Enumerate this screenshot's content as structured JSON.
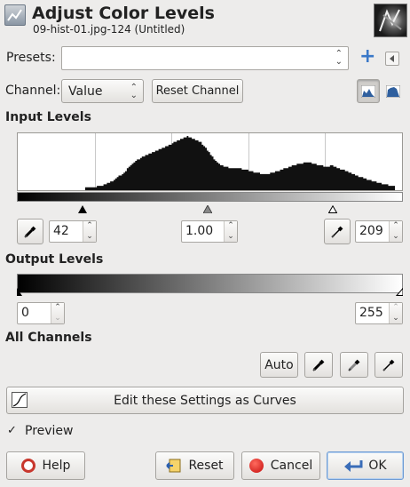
{
  "header": {
    "title": "Adjust Color Levels",
    "subtitle": "09-hist-01.jpg-124 (Untitled)"
  },
  "presets": {
    "label": "Presets:",
    "value": ""
  },
  "channel": {
    "label": "Channel:",
    "value": "Value",
    "reset_label": "Reset Channel"
  },
  "input_levels": {
    "heading": "Input Levels",
    "low": "42",
    "gamma": "1.00",
    "high": "209"
  },
  "output_levels": {
    "heading": "Output Levels",
    "low": "0",
    "high": "255"
  },
  "all_channels": {
    "heading": "All Channels",
    "auto_label": "Auto"
  },
  "curves_button": {
    "label": "Edit these Settings as Curves"
  },
  "preview": {
    "label": "Preview",
    "checked": true
  },
  "footer": {
    "help": "Help",
    "reset": "Reset",
    "cancel": "Cancel",
    "ok": "OK"
  },
  "histogram": [
    2,
    2,
    2,
    2,
    2,
    2,
    2,
    3,
    3,
    3,
    3,
    4,
    4,
    5,
    5,
    6,
    6,
    7,
    8,
    9,
    10,
    10,
    11,
    12,
    13,
    15,
    16,
    17,
    18,
    19,
    20,
    21,
    21,
    22,
    23,
    23,
    24,
    24,
    25,
    25,
    26,
    26,
    27,
    27,
    28,
    28,
    29,
    29,
    30,
    30,
    31,
    31,
    32,
    33,
    33,
    34,
    34,
    35,
    35,
    36,
    36,
    37,
    36,
    36,
    35,
    35,
    34,
    34,
    33,
    33,
    31,
    30,
    29,
    27,
    26,
    24,
    23,
    21,
    20,
    19,
    18,
    17,
    17,
    16,
    16,
    16,
    15,
    15,
    15,
    15,
    15,
    15,
    15,
    15,
    14,
    14,
    14,
    14,
    13,
    13,
    13,
    12,
    12,
    12,
    12,
    11,
    11,
    11,
    11,
    11,
    11,
    12,
    12,
    12,
    13,
    13,
    13,
    14,
    14,
    15,
    15,
    15,
    16,
    16,
    17,
    17,
    17,
    18,
    18,
    18,
    18,
    19,
    19,
    19,
    19,
    19,
    18,
    18,
    18,
    17,
    17,
    17,
    17,
    16,
    16,
    16,
    16,
    17,
    17,
    16,
    16,
    15,
    15,
    14,
    14,
    14,
    13,
    13,
    12,
    12,
    11,
    11,
    10,
    10,
    9,
    9,
    9,
    8,
    8,
    7,
    7,
    7,
    6,
    6,
    6,
    5,
    5,
    5,
    4,
    4,
    4,
    4,
    3,
    3,
    3,
    3
  ]
}
